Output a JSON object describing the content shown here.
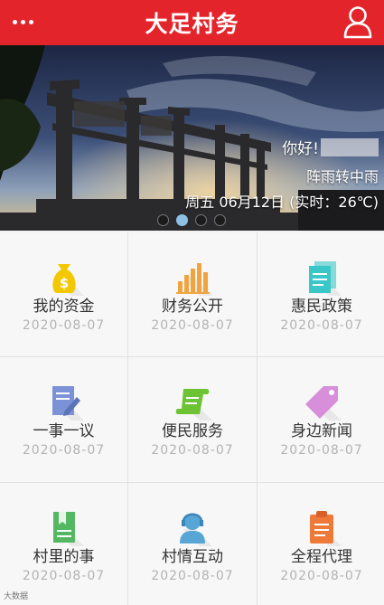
{
  "header": {
    "title": "大足村务",
    "menu_icon": "more-dots-icon",
    "user_icon": "user-profile-icon",
    "background": "#e4242b"
  },
  "banner": {
    "greeting": "你好!",
    "weather": "阵雨转中雨",
    "date_line": "周五 06月12日 (实时：26℃)",
    "slides": 4,
    "active_slide": 2
  },
  "services": [
    {
      "label": "我的资金",
      "date": "2020-08-07",
      "icon": "money-bag-icon",
      "color": "#f3c800"
    },
    {
      "label": "财务公开",
      "date": "2020-08-07",
      "icon": "bar-chart-icon",
      "color": "#f0a440"
    },
    {
      "label": "惠民政策",
      "date": "2020-08-07",
      "icon": "documents-icon",
      "color": "#3bc7c7"
    },
    {
      "label": "一事一议",
      "date": "2020-08-07",
      "icon": "edit-document-icon",
      "color": "#7b93d6"
    },
    {
      "label": "便民服务",
      "date": "2020-08-07",
      "icon": "scroll-icon",
      "color": "#6cc333"
    },
    {
      "label": "身边新闻",
      "date": "2020-08-07",
      "icon": "tag-icon",
      "color": "#d68fd8"
    },
    {
      "label": "村里的事",
      "date": "2020-08-07",
      "icon": "bookmark-document-icon",
      "color": "#54b862"
    },
    {
      "label": "村情互动",
      "date": "2020-08-07",
      "icon": "customer-service-icon",
      "color": "#57a6d6"
    },
    {
      "label": "全程代理",
      "date": "2020-08-07",
      "icon": "clipboard-icon",
      "color": "#ee7a3a"
    }
  ],
  "watermark": "大数据"
}
